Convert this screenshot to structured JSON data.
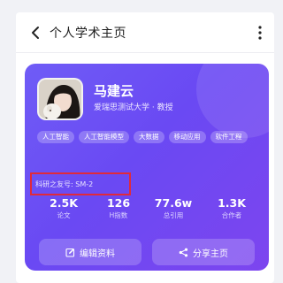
{
  "header": {
    "title": "个人学术主页",
    "back_icon": "chevron-left-icon",
    "more_icon": "more-vertical-icon"
  },
  "profile": {
    "name": "马建云",
    "affiliation": "爱瑞思测试大学 · 教授",
    "tags": [
      "人工智能",
      "人工智能模型",
      "大数据",
      "移动应用",
      "软件工程"
    ],
    "sciid": "科研之友号: SM-2",
    "highlight_color": "#e02a3a"
  },
  "stats": [
    {
      "value": "2.5K",
      "label": "论文"
    },
    {
      "value": "126",
      "label": "H指数"
    },
    {
      "value": "77.6w",
      "label": "总引用"
    },
    {
      "value": "1.3K",
      "label": "合作者"
    }
  ],
  "actions": {
    "edit_label": "编辑资料",
    "edit_icon": "edit-icon",
    "share_label": "分享主页",
    "share_icon": "share-icon"
  },
  "colors": {
    "card_gradient_start": "#6f5cf6",
    "card_gradient_end": "#7d45ef"
  }
}
